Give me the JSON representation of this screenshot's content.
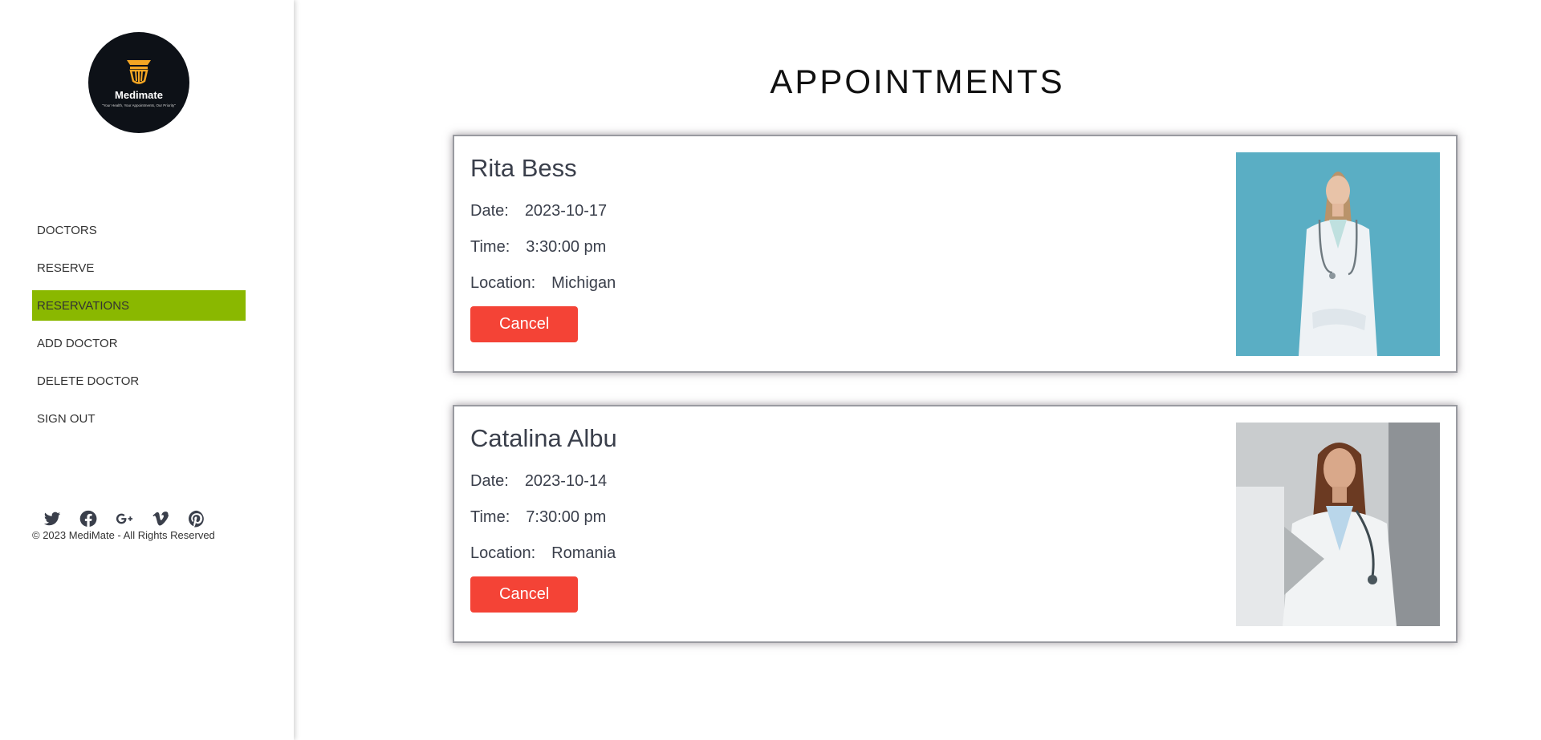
{
  "brand": {
    "name": "Medimate",
    "tagline": "\"Your Health, Your Appointments, Our Priority\"",
    "logo_icon": "pillar-icon"
  },
  "sidebar": {
    "items": [
      {
        "label": "DOCTORS",
        "active": false
      },
      {
        "label": "RESERVE",
        "active": false
      },
      {
        "label": "RESERVATIONS",
        "active": true
      },
      {
        "label": "ADD DOCTOR",
        "active": false
      },
      {
        "label": "DELETE DOCTOR",
        "active": false
      },
      {
        "label": "SIGN OUT",
        "active": false
      }
    ],
    "socials": [
      "twitter-icon",
      "facebook-icon",
      "google-plus-icon",
      "vimeo-icon",
      "pinterest-icon"
    ],
    "copyright": "© 2023 MediMate - All Rights Reserved"
  },
  "main": {
    "title": "APPOINTMENTS",
    "appointments": [
      {
        "doctor": "Rita Bess",
        "date_label": "Date:",
        "date": "2023-10-17",
        "time_label": "Time:",
        "time": "3:30:00 pm",
        "location_label": "Location:",
        "location": "Michigan",
        "cancel_label": "Cancel"
      },
      {
        "doctor": "Catalina Albu",
        "date_label": "Date:",
        "date": "2023-10-14",
        "time_label": "Time:",
        "time": "7:30:00 pm",
        "location_label": "Location:",
        "location": "Romania",
        "cancel_label": "Cancel"
      }
    ]
  },
  "colors": {
    "active_nav": "#8ab800",
    "cancel_button": "#f44336",
    "logo_bg": "#0d1117",
    "logo_accent": "#f5a623"
  }
}
